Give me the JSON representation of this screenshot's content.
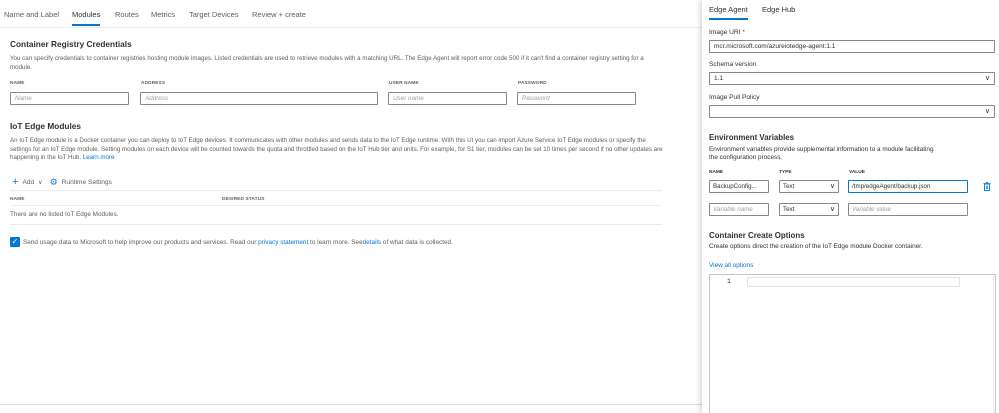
{
  "tabs": [
    "Name and Label",
    "Modules",
    "Routes",
    "Metrics",
    "Target Devices",
    "Review + create"
  ],
  "registry": {
    "title": "Container Registry Credentials",
    "description": "You can specify credentials to container registries hosting module images. Listed credentials are used to retrieve modules with a matching URL. The Edge Agent will report error code 500 if it can't find a container registry setting for a module.",
    "columns": {
      "name": "NAME",
      "address": "ADDRESS",
      "username": "USER NAME",
      "password": "PASSWORD"
    },
    "placeholders": {
      "name": "Name",
      "address": "Address",
      "username": "User name",
      "password": "Password"
    }
  },
  "modules": {
    "title": "IoT Edge Modules",
    "description": "An IoT Edge module is a Docker container you can deploy to IoT Edge devices. It communicates with other modules and sends data to the IoT Edge runtime. With this UI you can import Azure Service IoT Edge modules or specify the settings for an IoT Edge module. Setting modules on each device will be counted towards the quota and throttled based on the IoT Hub tier and units. For example, for S1 tier, modules can be set 10 times per second if no other updates are happening in the IoT Hub.",
    "learn_more": "Learn more",
    "add_label": "Add",
    "runtime_settings_label": "Runtime Settings",
    "columns": {
      "name": "NAME",
      "desired_status": "DESIRED STATUS"
    },
    "empty_text": "There are no listed IoT Edge Modules."
  },
  "consent": {
    "prefix": "Send usage data to Microsoft to help improve our products and services. Read our",
    "privacy_link": "privacy statement",
    "middle": "to learn more. See",
    "details_link": "details",
    "suffix": "of what data is collected."
  },
  "panel": {
    "tabs": [
      "Edge Agent",
      "Edge Hub"
    ],
    "image_uri": {
      "label": "Image URI",
      "required_mark": "*",
      "value": "mcr.microsoft.com/azureiotedge-agent:1.1"
    },
    "schema_version": {
      "label": "Schema version",
      "value": "1.1"
    },
    "image_pull_policy": {
      "label": "Image Pull Policy",
      "value": ""
    },
    "env": {
      "title": "Environment Variables",
      "description": "Environment variables provide supplemental information to a module facilitating the configuration process.",
      "columns": {
        "name": "NAME",
        "type": "TYPE",
        "value": "VALUE"
      },
      "rows": [
        {
          "name": "BackupConfig...",
          "type": "Text",
          "value": "/tmp/edgeAgent/backup.json"
        }
      ],
      "new_row": {
        "name_placeholder": "Variable name",
        "type": "Text",
        "value_placeholder": "Variable value"
      }
    },
    "create_options": {
      "title": "Container Create Options",
      "description": "Create options direct the creation of the IoT Edge module Docker container.",
      "link": "View all options",
      "line_number": "1"
    }
  },
  "colors": {
    "accent": "#0078d4",
    "text": "#323130",
    "secondary": "#605e5c",
    "border": "#8a8886"
  },
  "icons": [
    "plus-icon",
    "gear-icon",
    "chevron-down-icon",
    "trash-icon",
    "checkmark-icon"
  ]
}
